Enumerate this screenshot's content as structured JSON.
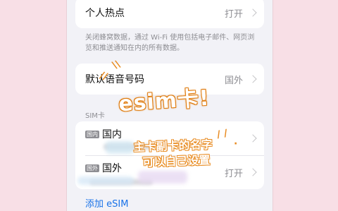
{
  "hotspot_row": {
    "label": "个人热点",
    "value": "打开"
  },
  "hotspot_footnote": "关闭蜂窝数据，通过 Wi-Fi 使用包括电子邮件、网页浏览和推送通知在内的所有数据。",
  "default_voice_row": {
    "label": "默认语音号码",
    "value": "国外"
  },
  "sim_section_header": "SIM卡",
  "sim_rows": [
    {
      "badge": "国内",
      "label": "国内",
      "value": ""
    },
    {
      "badge": "国外",
      "label": "国外",
      "value": "打开"
    }
  ],
  "add_esim_label": "添加 eSIM",
  "overlay": {
    "title": "esim卡!",
    "note_line1": "主卡副卡的名字",
    "note_line2": "可以自己设置"
  },
  "colors": {
    "page_background": "#f8dfe6",
    "screen_background": "#f2f2f7",
    "link_blue": "#1a73e8",
    "annotation_orange": "#e88a1f"
  }
}
